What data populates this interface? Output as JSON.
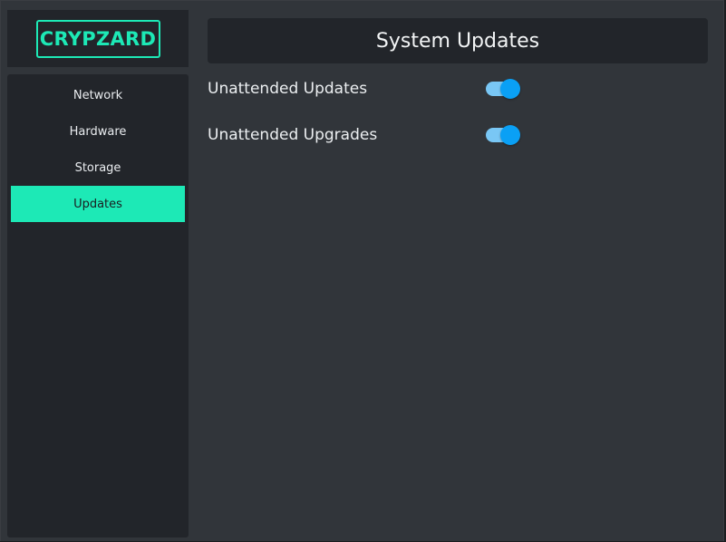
{
  "brand": {
    "logo_text": "CRYPZARD",
    "accent_color": "#1de9b6"
  },
  "sidebar": {
    "items": [
      {
        "label": "Network",
        "active": false
      },
      {
        "label": "Hardware",
        "active": false
      },
      {
        "label": "Storage",
        "active": false
      },
      {
        "label": "Updates",
        "active": true
      }
    ]
  },
  "main": {
    "title": "System Updates",
    "settings": [
      {
        "label": "Unattended Updates",
        "enabled": true
      },
      {
        "label": "Unattended Upgrades",
        "enabled": true
      }
    ],
    "toggle_color": "#0aa0f5"
  }
}
